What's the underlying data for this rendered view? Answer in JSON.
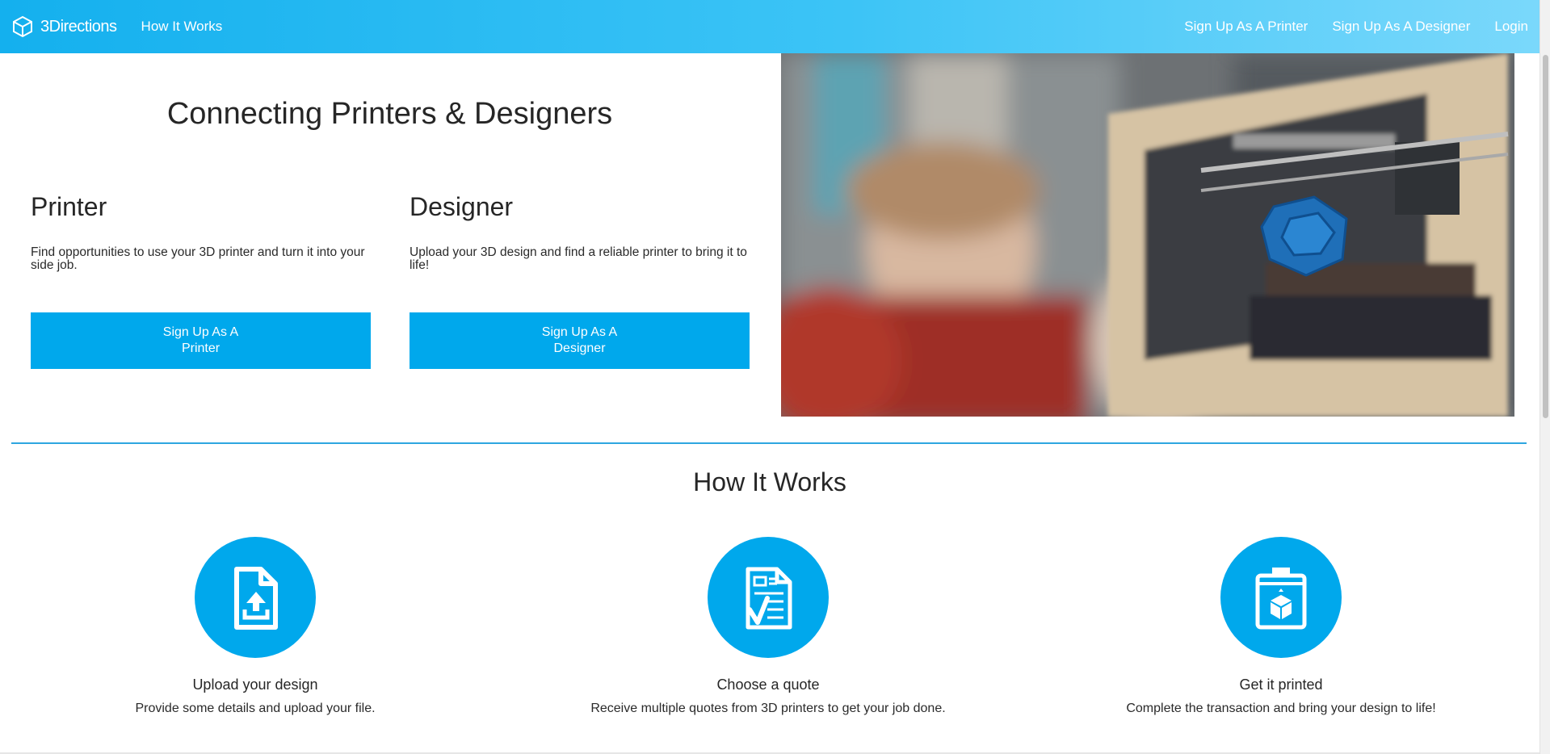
{
  "nav": {
    "brand": "3Directions",
    "how_it_works": "How It Works",
    "signup_printer": "Sign Up As A Printer",
    "signup_designer": "Sign Up As A Designer",
    "login": "Login"
  },
  "hero": {
    "title": "Connecting Printers & Designers",
    "printer": {
      "heading": "Printer",
      "description": "Find opportunities to use your 3D printer and turn it into your side job.",
      "button": "Sign Up As A Printer"
    },
    "designer": {
      "heading": "Designer",
      "description": "Upload your 3D design and find a reliable printer to bring it to life!",
      "button": "Sign Up As A Designer"
    }
  },
  "how_it_works": {
    "title": "How It Works",
    "steps": [
      {
        "title": "Upload your design",
        "description": "Provide some details and upload your file.",
        "icon": "file-upload-icon"
      },
      {
        "title": "Choose a quote",
        "description": "Receive multiple quotes from 3D printers to get your job done.",
        "icon": "quote-checklist-icon"
      },
      {
        "title": "Get it printed",
        "description": "Complete the transaction and bring your design to life!",
        "icon": "3d-printer-icon"
      }
    ]
  },
  "colors": {
    "accent": "#00a8ec",
    "nav_start": "#14b0ee",
    "nav_end": "#7ad8fb",
    "divider": "#2ea6e0"
  }
}
